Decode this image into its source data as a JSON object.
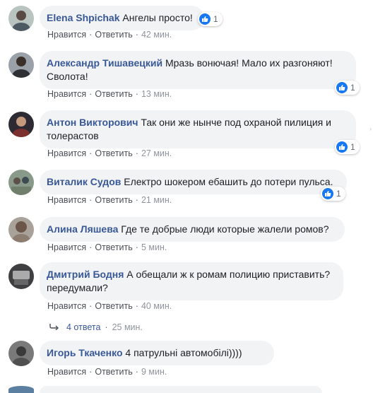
{
  "actions": {
    "like": "Нравится",
    "reply": "Ответить",
    "separator": "·"
  },
  "comments": [
    {
      "author": "Elena Shpichak",
      "text": "Ангелы просто!",
      "time": "42 мин.",
      "reactions": "1"
    },
    {
      "author": "Александр Тишавецкий",
      "text": "Мразь вонючая! Мало их разгоняют! Сволота!",
      "time": "13 мин.",
      "reactions": "1"
    },
    {
      "author": "Антон Викторович",
      "text": "Так они же нынче под охраной пилиция и толерастов",
      "time": "27 мин.",
      "reactions": "1"
    },
    {
      "author": "Виталик Судов",
      "text": "Електро шокером ебашить до потери пульса.",
      "time": "21 мин.",
      "reactions": "1"
    },
    {
      "author": "Алина Ляшева",
      "text": "Где те добрые люди которые жалели ромов?",
      "time": "5 мин.",
      "reactions": ""
    },
    {
      "author": "Дмитрий Бодня",
      "text": "А обещали ж к ромам полицию приставить? передумали?",
      "time": "40 мин.",
      "reactions": ""
    },
    {
      "author": "Игорь Ткаченко",
      "text": "4 патрульні автомобілі))))",
      "time": "9 мин.",
      "reactions": ""
    }
  ],
  "replies": {
    "count_label": "4 ответа",
    "time": "25 мин."
  },
  "colors": {
    "author": "#385898",
    "bubble": "#f2f3f5",
    "like": "#1877f2"
  }
}
